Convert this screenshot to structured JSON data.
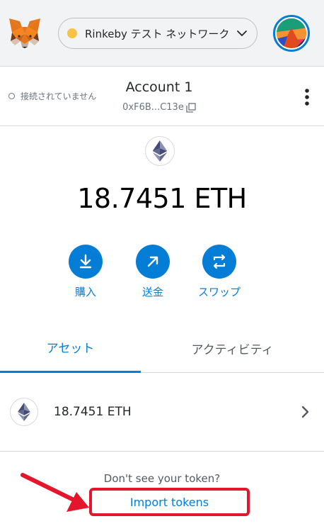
{
  "header": {
    "network_label": "Rinkeby テスト ネットワーク",
    "network_dot_color": "#f6c343"
  },
  "account": {
    "connection_status": "接続されていません",
    "name": "Account 1",
    "address": "0xF6B...C13e"
  },
  "balance": {
    "amount": "18.7451 ETH"
  },
  "actions": [
    {
      "label": "購入",
      "icon": "download-icon"
    },
    {
      "label": "送金",
      "icon": "arrow-up-right-icon"
    },
    {
      "label": "スワップ",
      "icon": "swap-icon"
    }
  ],
  "tabs": [
    {
      "label": "アセット",
      "active": true
    },
    {
      "label": "アクティビティ",
      "active": false
    }
  ],
  "assets": [
    {
      "amount": "18.7451 ETH",
      "icon": "ethereum-icon"
    }
  ],
  "footer": {
    "prompt": "Don't see your token?",
    "import_label": "Import tokens"
  },
  "colors": {
    "accent": "#037dd6",
    "annotation": "#e4162b"
  }
}
